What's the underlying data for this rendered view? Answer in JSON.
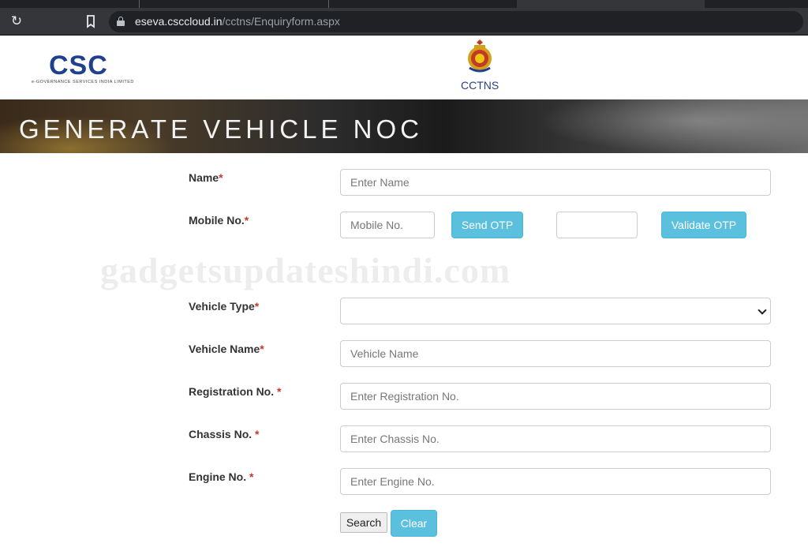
{
  "browser": {
    "url_host": "eseva.csccloud.in",
    "url_path": "/cctns/Enquiryform.aspx"
  },
  "header": {
    "csc_letters": "CSC",
    "csc_tagline": "e-GOVERNANCE SERVICES INDIA LIMITED",
    "cctns_label": "CCTNS"
  },
  "banner": {
    "title": "GENERATE VEHICLE NOC"
  },
  "form": {
    "name": {
      "label": "Name",
      "placeholder": "Enter Name"
    },
    "mobile": {
      "label": "Mobile No.",
      "placeholder": "Mobile No.",
      "send_otp": "Send OTP",
      "otp_value": "",
      "validate_otp": "Validate OTP"
    },
    "vehicle_type": {
      "label": "Vehicle Type",
      "selected": ""
    },
    "vehicle_name": {
      "label": "Vehicle Name",
      "placeholder": "Vehicle Name"
    },
    "registration": {
      "label": "Registration No. ",
      "placeholder": "Enter Registration No."
    },
    "chassis": {
      "label": "Chassis No. ",
      "placeholder": "Enter Chassis No."
    },
    "engine": {
      "label": "Engine No. ",
      "placeholder": "Enter Engine No."
    },
    "required_mark": "*",
    "search_button": "Search",
    "clear_button": "Clear"
  },
  "watermark": "gadgetsupdateshindi.com",
  "colors": {
    "primary_blue": "#1f3f8f",
    "info_button": "#5bc0de",
    "required": "#c0392b"
  }
}
